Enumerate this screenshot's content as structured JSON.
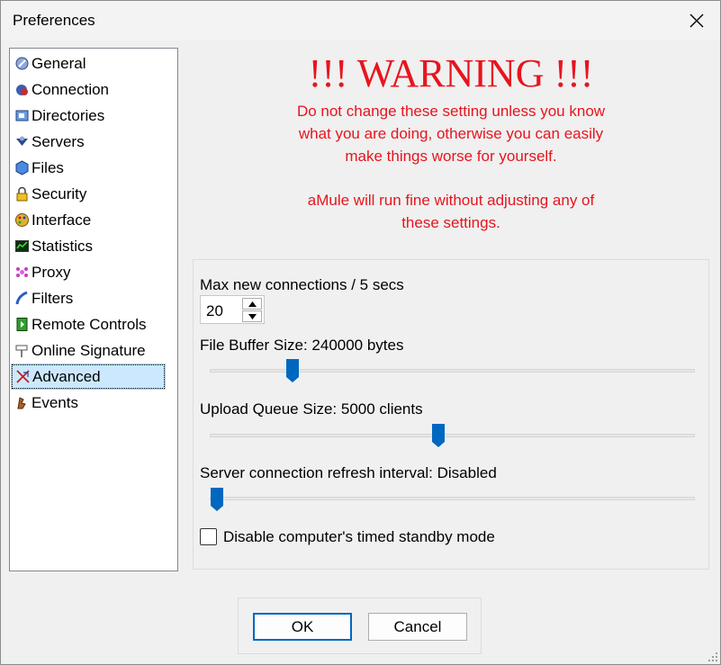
{
  "window": {
    "title": "Preferences"
  },
  "sidebar": {
    "items": [
      {
        "label": "General",
        "icon": "general-icon"
      },
      {
        "label": "Connection",
        "icon": "connection-icon"
      },
      {
        "label": "Directories",
        "icon": "directories-icon"
      },
      {
        "label": "Servers",
        "icon": "servers-icon"
      },
      {
        "label": "Files",
        "icon": "files-icon"
      },
      {
        "label": "Security",
        "icon": "lock-icon"
      },
      {
        "label": "Interface",
        "icon": "interface-icon"
      },
      {
        "label": "Statistics",
        "icon": "statistics-icon"
      },
      {
        "label": "Proxy",
        "icon": "proxy-icon"
      },
      {
        "label": "Filters",
        "icon": "filters-icon"
      },
      {
        "label": "Remote Controls",
        "icon": "remote-controls-icon"
      },
      {
        "label": "Online Signature",
        "icon": "signpost-icon"
      },
      {
        "label": "Advanced",
        "icon": "advanced-icon"
      },
      {
        "label": "Events",
        "icon": "events-icon"
      }
    ],
    "selected": "Advanced"
  },
  "warning": {
    "title": "!!! WARNING !!!",
    "lines": [
      "Do not change these setting unless you know",
      "what you are doing, otherwise you can easily",
      "make things worse for yourself.",
      "aMule will run fine without adjusting any of",
      "these settings."
    ],
    "color": "#e8141e"
  },
  "settings": {
    "max_conn_label": "Max new connections / 5 secs",
    "max_conn_value": "20",
    "file_buffer_label": "File Buffer Size: 240000 bytes",
    "file_buffer_fraction": 0.16,
    "upload_queue_label": "Upload Queue Size: 5000 clients",
    "upload_queue_fraction": 0.47,
    "server_refresh_label": "Server connection refresh interval: Disabled",
    "server_refresh_fraction": 0.0,
    "standby_label": "Disable computer's timed standby mode",
    "standby_checked": false
  },
  "buttons": {
    "ok": "OK",
    "cancel": "Cancel"
  },
  "colors": {
    "accent": "#0067c0",
    "selection": "#cce8ff"
  }
}
